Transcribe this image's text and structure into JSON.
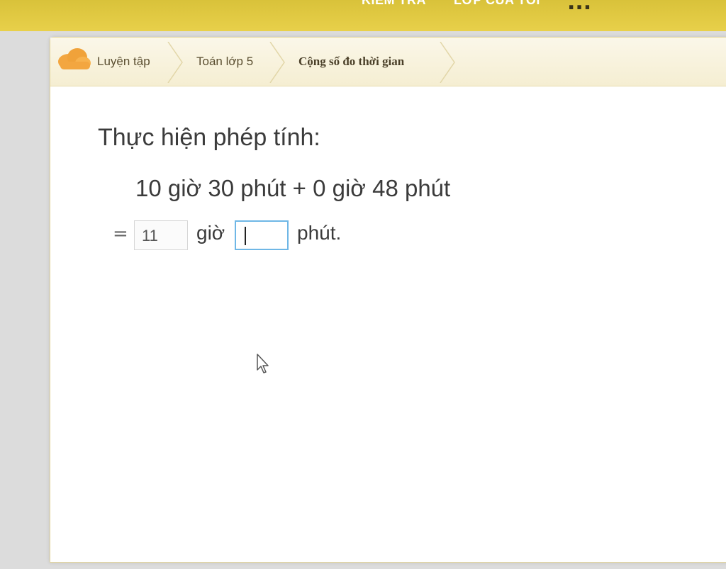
{
  "top_nav": {
    "items": [
      "KIỂM TRA",
      "LỚP CỦA TÔI"
    ],
    "more_label": "..."
  },
  "breadcrumb": {
    "items": [
      {
        "label": "Luyện tập"
      },
      {
        "label": "Toán lớp 5"
      },
      {
        "label": "Cộng số đo thời gian"
      }
    ]
  },
  "exercise": {
    "heading": "Thực hiện phép tính:",
    "expression": "10 giờ 30 phút + 0 giờ 48 phút",
    "answer": {
      "equals": "=",
      "hours_value": "11",
      "hours_unit": "giờ",
      "minutes_value": "",
      "minutes_unit": "phút."
    }
  },
  "colors": {
    "top_bar": "#e3cc45",
    "breadcrumb_bg": "#f8f2dc",
    "active_input_border": "#6fb7e6",
    "logo": "#f0a23a"
  },
  "icons": {
    "logo": "cloud-logo-icon",
    "pointer": "mouse-pointer-icon"
  }
}
